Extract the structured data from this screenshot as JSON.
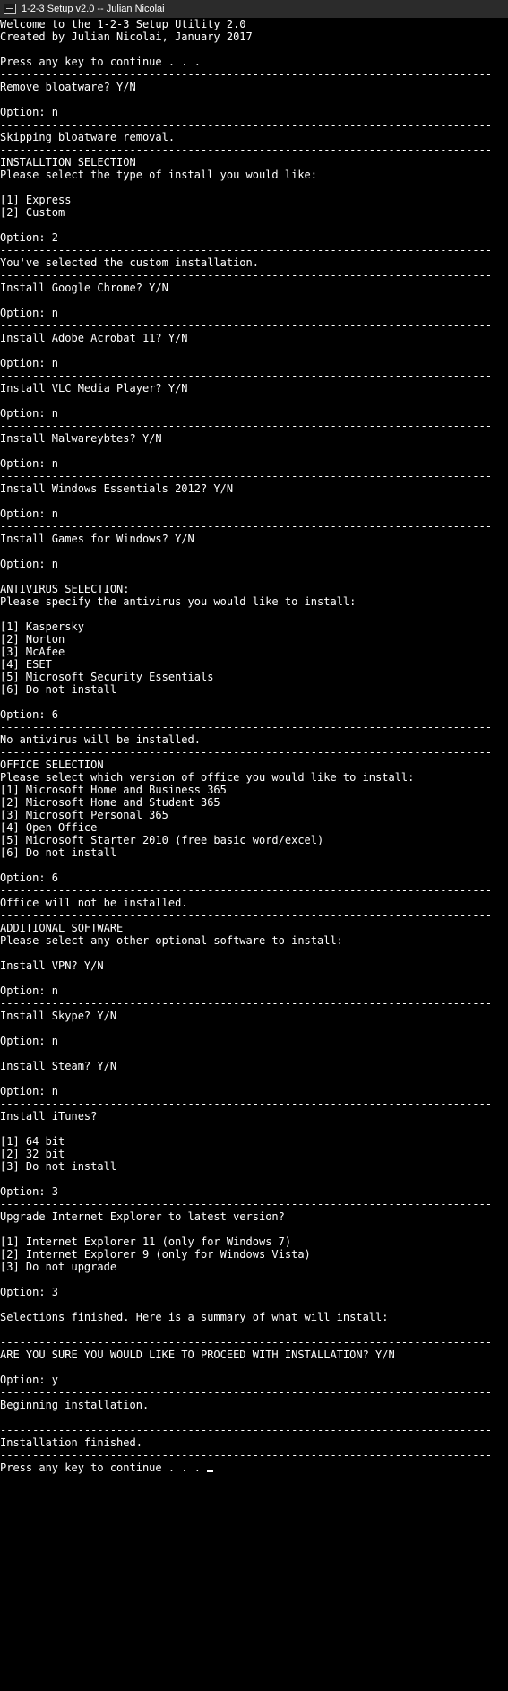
{
  "window": {
    "title": "1-2-3 Setup v2.0 -- Julian Nicolai"
  },
  "separator": "----------------------------------------------------------------------------",
  "lines": [
    "Welcome to the 1-2-3 Setup Utility 2.0",
    "Created by Julian Nicolai, January 2017",
    "",
    "Press any key to continue . . .",
    "SEP",
    "Remove bloatware? Y/N",
    "",
    "Option: n",
    "SEP",
    "Skipping bloatware removal.",
    "SEP",
    "INSTALLTION SELECTION",
    "Please select the type of install you would like:",
    "",
    "[1] Express",
    "[2] Custom",
    "",
    "Option: 2",
    "SEP",
    "You've selected the custom installation.",
    "SEP",
    "Install Google Chrome? Y/N",
    "",
    "Option: n",
    "SEP",
    "Install Adobe Acrobat 11? Y/N",
    "",
    "Option: n",
    "SEP",
    "Install VLC Media Player? Y/N",
    "",
    "Option: n",
    "SEP",
    "Install Malwareybtes? Y/N",
    "",
    "Option: n",
    "SEP",
    "Install Windows Essentials 2012? Y/N",
    "",
    "Option: n",
    "SEP",
    "Install Games for Windows? Y/N",
    "",
    "Option: n",
    "SEP",
    "ANTIVIRUS SELECTION:",
    "Please specify the antivirus you would like to install:",
    "",
    "[1] Kaspersky",
    "[2] Norton",
    "[3] McAfee",
    "[4] ESET",
    "[5] Microsoft Security Essentials",
    "[6] Do not install",
    "",
    "Option: 6",
    "SEP",
    "No antivirus will be installed.",
    "SEP",
    "OFFICE SELECTION",
    "Please select which version of office you would like to install:",
    "[1] Microsoft Home and Business 365",
    "[2] Microsoft Home and Student 365",
    "[3] Microsoft Personal 365",
    "[4] Open Office",
    "[5] Microsoft Starter 2010 (free basic word/excel)",
    "[6] Do not install",
    "",
    "Option: 6",
    "SEP",
    "Office will not be installed.",
    "SEP",
    "ADDITIONAL SOFTWARE",
    "Please select any other optional software to install:",
    "",
    "Install VPN? Y/N",
    "",
    "Option: n",
    "SEP",
    "Install Skype? Y/N",
    "",
    "Option: n",
    "SEP",
    "Install Steam? Y/N",
    "",
    "Option: n",
    "SEP",
    "Install iTunes?",
    "",
    "[1] 64 bit",
    "[2] 32 bit",
    "[3] Do not install",
    "",
    "Option: 3",
    "SEP",
    "Upgrade Internet Explorer to latest version?",
    "",
    "[1] Internet Explorer 11 (only for Windows 7)",
    "[2] Internet Explorer 9 (only for Windows Vista)",
    "[3] Do not upgrade",
    "",
    "Option: 3",
    "SEP",
    "Selections finished. Here is a summary of what will install:",
    "",
    "SEP",
    "ARE YOU SURE YOU WOULD LIKE TO PROCEED WITH INSTALLATION? Y/N",
    "",
    "Option: y",
    "SEP",
    "Beginning installation.",
    "",
    "SEP",
    "Installation finished.",
    "SEP",
    "Press any key to continue . . . CURSOR"
  ]
}
